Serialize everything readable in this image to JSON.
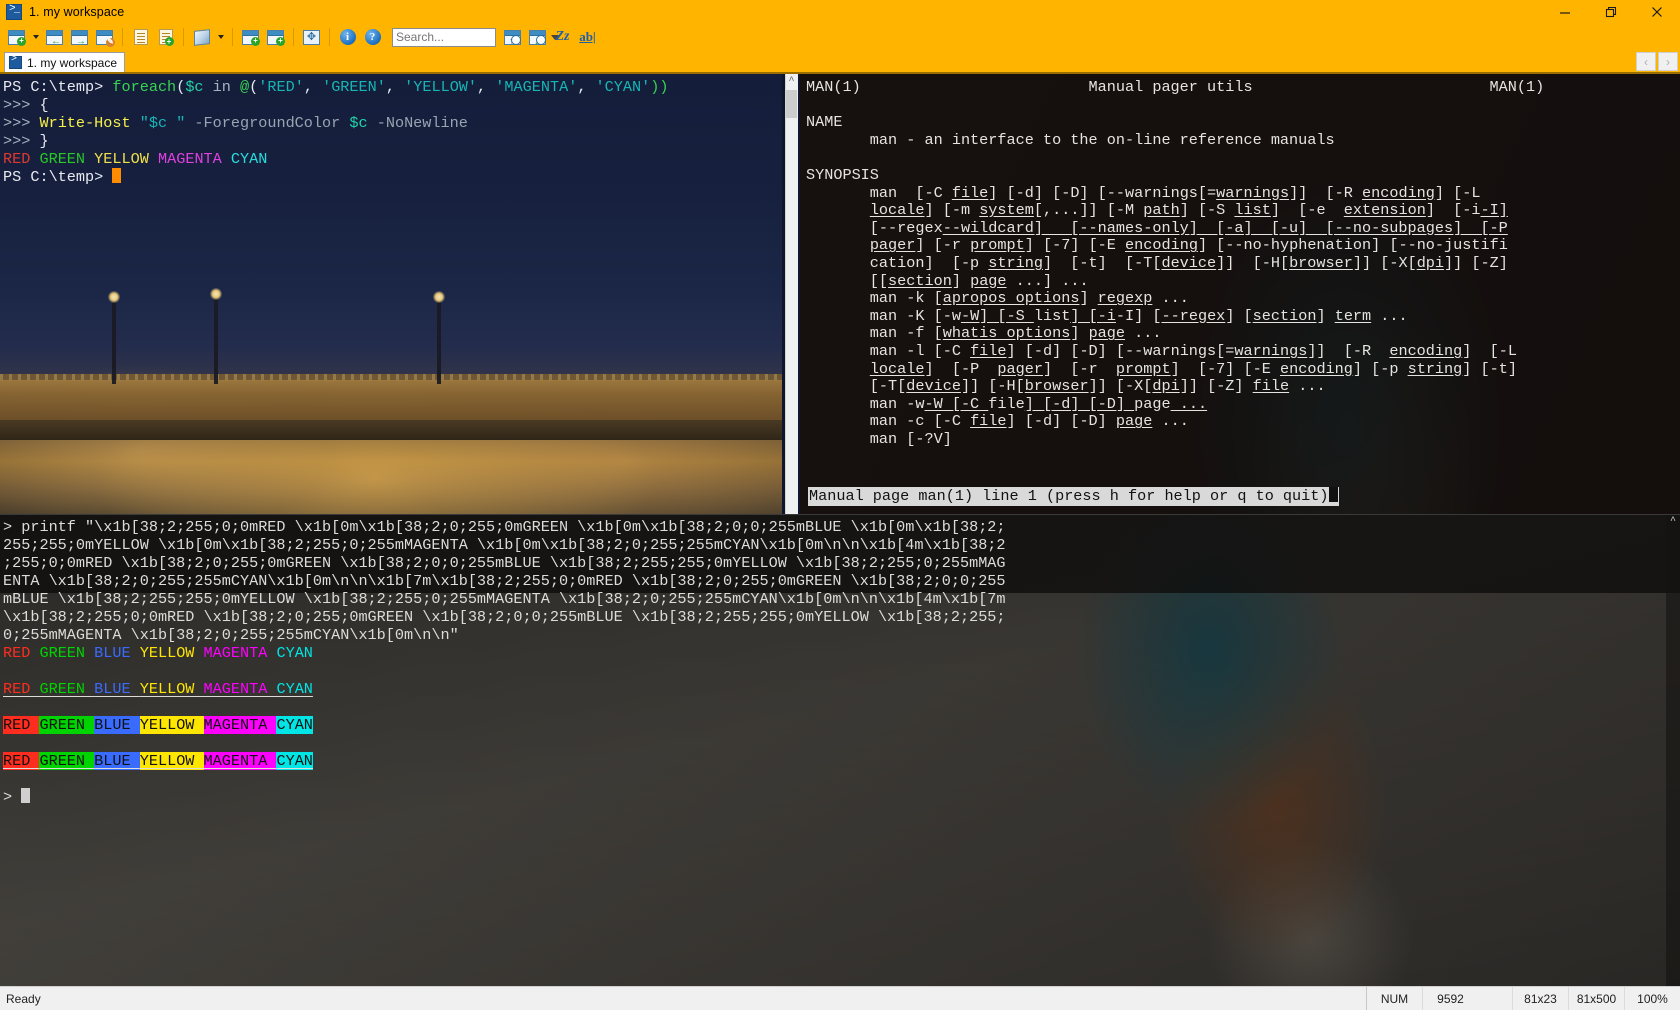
{
  "window": {
    "title": "1. my workspace",
    "icon": "powershell-icon",
    "minimize_label": "Minimize",
    "restore_label": "Restore",
    "close_label": "Close"
  },
  "toolbar": {
    "items": [
      {
        "name": "new-console",
        "icon": "new-window-icon",
        "label": "New console"
      },
      {
        "name": "new-console-dropdown",
        "icon": "chevron-down-icon",
        "label": "New console options"
      },
      {
        "name": "split-left",
        "icon": "split-left-icon",
        "label": "Split left"
      },
      {
        "name": "split-right",
        "icon": "split-right-icon",
        "label": "Split right"
      },
      {
        "name": "rename-tab",
        "icon": "pencil-window-icon",
        "label": "Rename tab"
      },
      {
        "name": "copy-buffer",
        "icon": "list-icon",
        "label": "Copy"
      },
      {
        "name": "paste-buffer",
        "icon": "clipboard-plus-icon",
        "label": "Paste"
      },
      {
        "name": "package",
        "icon": "cube-icon",
        "label": "Package"
      },
      {
        "name": "package-dropdown",
        "icon": "chevron-down-icon",
        "label": "Package options"
      },
      {
        "name": "split-horizontal",
        "icon": "split-horizontal-icon",
        "label": "Split horizontally"
      },
      {
        "name": "split-vertical",
        "icon": "split-vertical-icon",
        "label": "Split vertically"
      },
      {
        "name": "fullscreen",
        "icon": "expand-icon",
        "label": "Full screen"
      },
      {
        "name": "info",
        "icon": "info-icon",
        "label": "Info"
      },
      {
        "name": "help",
        "icon": "help-icon",
        "label": "Help"
      }
    ],
    "search": {
      "placeholder": "Search...",
      "value": "",
      "dropdown_icon": "chevron-down-icon"
    },
    "search_tools": [
      {
        "name": "find-previous",
        "icon": "find-up-icon",
        "label": "Find previous"
      },
      {
        "name": "find-next",
        "icon": "find-down-icon",
        "label": "Find next"
      },
      {
        "name": "match-case",
        "icon": "match-case-icon",
        "label": "Match case"
      },
      {
        "name": "match-whole-word",
        "icon": "whole-word-icon",
        "label": "Match whole word"
      }
    ]
  },
  "tabs": {
    "items": [
      {
        "label": "1. my workspace",
        "icon": "powershell-icon",
        "active": true
      }
    ],
    "nav_prev": "‹",
    "nav_next": "›"
  },
  "powershell_pane": {
    "lines": [
      {
        "segments": [
          {
            "t": "PS C:\\temp> ",
            "c": "prompt"
          },
          {
            "t": "foreach",
            "c": "kw"
          },
          {
            "t": "(",
            "c": "op"
          },
          {
            "t": "$c",
            "c": "var"
          },
          {
            "t": " in ",
            "c": "gray"
          },
          {
            "t": "@",
            "c": "kw"
          },
          {
            "t": "(",
            "c": "op"
          },
          {
            "t": "'RED'",
            "c": "str"
          },
          {
            "t": ", ",
            "c": "op"
          },
          {
            "t": "'GREEN'",
            "c": "str"
          },
          {
            "t": ", ",
            "c": "op"
          },
          {
            "t": "'YELLOW'",
            "c": "str"
          },
          {
            "t": ", ",
            "c": "op"
          },
          {
            "t": "'MAGENTA'",
            "c": "str"
          },
          {
            "t": ", ",
            "c": "op"
          },
          {
            "t": "'CYAN'",
            "c": "str"
          },
          {
            "t": "))",
            "c": "kw"
          }
        ]
      },
      {
        "segments": [
          {
            "t": ">>> ",
            "c": "gray"
          },
          {
            "t": "{",
            "c": "w"
          }
        ]
      },
      {
        "segments": [
          {
            "t": ">>> ",
            "c": "gray"
          },
          {
            "t": "Write-Host",
            "c": "cmd"
          },
          {
            "t": " ",
            "c": "w"
          },
          {
            "t": "\"$c \"",
            "c": "str"
          },
          {
            "t": " -ForegroundColor ",
            "c": "prm"
          },
          {
            "t": "$c",
            "c": "var"
          },
          {
            "t": " -NoNewline",
            "c": "prm"
          }
        ]
      },
      {
        "segments": [
          {
            "t": ">>> ",
            "c": "gray"
          },
          {
            "t": "}",
            "c": "w"
          }
        ]
      },
      {
        "segments": [
          {
            "t": "RED",
            "c": "o-red"
          },
          {
            "t": " ",
            "c": "w"
          },
          {
            "t": "GREEN",
            "c": "o-green"
          },
          {
            "t": " ",
            "c": "w"
          },
          {
            "t": "YELLOW",
            "c": "o-yellow"
          },
          {
            "t": " ",
            "c": "w"
          },
          {
            "t": "MAGENTA",
            "c": "o-mag"
          },
          {
            "t": " ",
            "c": "w"
          },
          {
            "t": "CYAN",
            "c": "o-cyan"
          }
        ]
      },
      {
        "segments": [
          {
            "t": "PS C:\\temp> ",
            "c": "prompt"
          }
        ],
        "cursor": true
      }
    ]
  },
  "man_pane": {
    "header_left": "MAN(1)",
    "header_center": "Manual pager utils",
    "header_right": "MAN(1)",
    "sections": [
      {
        "title": "NAME",
        "body": [
          "       man - an interface to the on-line reference manuals"
        ]
      },
      {
        "title": "SYNOPSIS",
        "body": [
          "       man  [-C |file|] [-d] [-D] [--warnings[=|warnings|]]  [-R |encoding|] [-L",
          "       |locale|] [-m |system|[,...]] [-M |path|] [-S |list|]  [-e  |extension|]  [-i|-I]",
          "       [--regex|--wildcard]   [--names-only]  [-a]  [-u]  [--no-subpages]  [-P",
          "       |pager|] [-r |prompt|] [-7] [-E |encoding|] [--no-hyphenation] [--no-justifi",
          "       cation]  [-p |string|]  [-t]  [-T[|device|]]  [-H[|browser|]] [-X[|dpi|]] [-Z]",
          "       [[|section|] |page| ...] ...",
          "       man -k [|apropos options|] |regexp| ...",
          "       man -K [-w|-W] [-S |list|] [-i|-I] [|--regex|] [|section|] |term| ...",
          "       man -f [|whatis options|] |page| ...",
          "       man -l [-C |file|] [-d] [-D] [--warnings[=|warnings|]]  [-R  |encoding|]  [-L",
          "       |locale|]  [-P  |pager|]  [-r  |prompt|]  [-7] [-E |encoding|] [-p |string|] [-t]",
          "       [-T[|device|]] [-H[|browser|]] [-X[|dpi|]] [-Z] |file| ...",
          "       man -w|-W [-C |file|] [-d] [-D] |page| ...",
          "       man -c [-C |file|] [-d] [-D] |page| ...",
          "       man [-?V]"
        ]
      }
    ],
    "status": "Manual page man(1) line 1 (press h for help or q to quit)"
  },
  "bash_pane": {
    "command_prompt": "> ",
    "command": "printf \"\\x1b[38;2;255;0;0mRED \\x1b[0m\\x1b[38;2;0;255;0mGREEN \\x1b[0m\\x1b[38;2;0;0;255mBLUE \\x1b[0m\\x1b[38;2;255;255;0mYELLOW \\x1b[0m\\x1b[38;2;255;0;255mMAGENTA \\x1b[0m\\x1b[38;2;0;255;255mCYAN\\x1b[0m\\n\\n\\x1b[4m\\x1b[38;2;255;0;0mRED \\x1b[38;2;0;255;0mGREEN \\x1b[38;2;0;0;255mBLUE \\x1b[38;2;255;255;0mYELLOW \\x1b[38;2;255;0;255mMAGENTA \\x1b[38;2;0;255;255mCYAN\\x1b[0m\\n\\n\\x1b[7m\\x1b[38;2;255;0;0mRED \\x1b[38;2;0;255;0mGREEN \\x1b[38;2;0;0;255mBLUE \\x1b[38;2;255;255;0mYELLOW \\x1b[38;2;255;0;255mMAGENTA \\x1b[38;2;0;255;255mCYAN\\x1b[0m\\n\\n\\x1b[4m\\x1b[7m\\x1b[38;2;255;0;0mRED \\x1b[38;2;0;255;0mGREEN \\x1b[38;2;0;0;255mBLUE \\x1b[38;2;255;255;0mYELLOW \\x1b[38;2;255;0;255mMAGENTA \\x1b[38;2;0;255;255mCYAN\\x1b[0m\\n\\n\"",
    "color_words": [
      "RED",
      "GREEN",
      "BLUE",
      "YELLOW",
      "MAGENTA",
      "CYAN"
    ],
    "colors": {
      "RED": "#ff2d20",
      "GREEN": "#00d400",
      "BLUE": "#3a6bff",
      "YELLOW": "#ffe600",
      "MAGENTA": "#ff00ff",
      "CYAN": "#00e5e5"
    },
    "rows": [
      {
        "style": "plain"
      },
      {
        "style": "underline"
      },
      {
        "style": "reverse"
      },
      {
        "style": "underline-reverse"
      }
    ],
    "final_prompt": "> "
  },
  "statusbar": {
    "ready": "Ready",
    "num": "NUM",
    "chars": "9592",
    "size1": "81x23",
    "size2": "81x500",
    "zoom": "100%"
  }
}
